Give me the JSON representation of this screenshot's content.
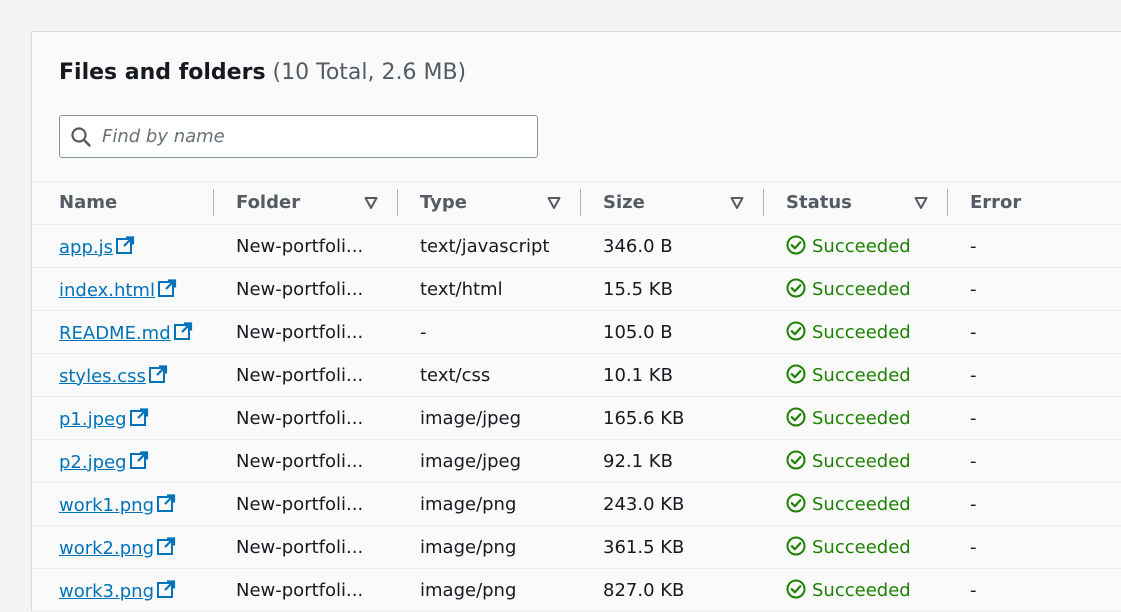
{
  "header": {
    "title": "Files and folders",
    "count": "(10 Total, 2.6 MB)"
  },
  "search": {
    "placeholder": "Find by name",
    "value": ""
  },
  "table": {
    "columns": [
      "Name",
      "Folder",
      "Type",
      "Size",
      "Status",
      "Error"
    ],
    "rows": [
      {
        "name": "app.js",
        "folder": "New-portfoli...",
        "type": "text/javascript",
        "size": "346.0 B",
        "status": "Succeeded",
        "error": "-"
      },
      {
        "name": "index.html",
        "folder": "New-portfoli...",
        "type": "text/html",
        "size": "15.5 KB",
        "status": "Succeeded",
        "error": "-"
      },
      {
        "name": "README.md",
        "folder": "New-portfoli...",
        "type": "-",
        "size": "105.0 B",
        "status": "Succeeded",
        "error": "-"
      },
      {
        "name": "styles.css",
        "folder": "New-portfoli...",
        "type": "text/css",
        "size": "10.1 KB",
        "status": "Succeeded",
        "error": "-"
      },
      {
        "name": "p1.jpeg",
        "folder": "New-portfoli...",
        "type": "image/jpeg",
        "size": "165.6 KB",
        "status": "Succeeded",
        "error": "-"
      },
      {
        "name": "p2.jpeg",
        "folder": "New-portfoli...",
        "type": "image/jpeg",
        "size": "92.1 KB",
        "status": "Succeeded",
        "error": "-"
      },
      {
        "name": "work1.png",
        "folder": "New-portfoli...",
        "type": "image/png",
        "size": "243.0 KB",
        "status": "Succeeded",
        "error": "-"
      },
      {
        "name": "work2.png",
        "folder": "New-portfoli...",
        "type": "image/png",
        "size": "361.5 KB",
        "status": "Succeeded",
        "error": "-"
      },
      {
        "name": "work3.png",
        "folder": "New-portfoli...",
        "type": "image/png",
        "size": "827.0 KB",
        "status": "Succeeded",
        "error": "-"
      }
    ]
  },
  "colors": {
    "link": "#0073bb",
    "success": "#1d8102"
  },
  "icons": {
    "search": "search-icon",
    "sort": "sort-caret-down-icon",
    "external": "external-link-icon",
    "success": "check-circle-icon"
  }
}
